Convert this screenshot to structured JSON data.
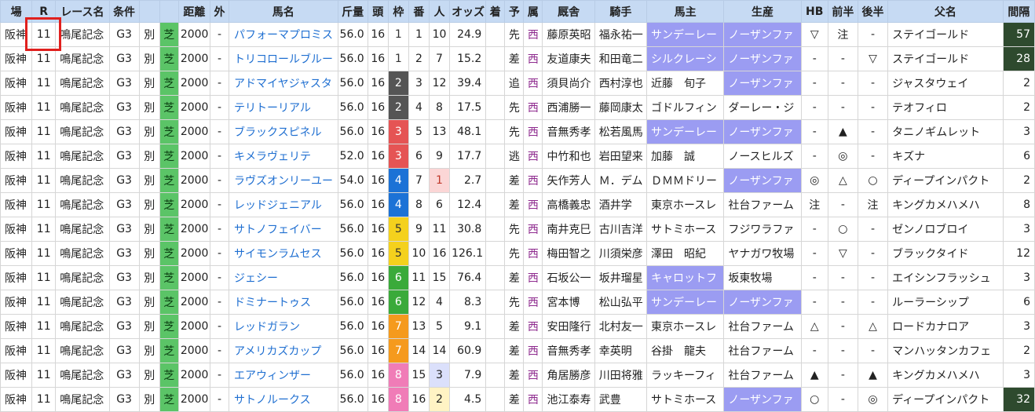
{
  "columns": [
    "場",
    "R",
    "レース名",
    "条件",
    "",
    "",
    "距離",
    "外",
    "馬名",
    "斤量",
    "頭",
    "枠",
    "番",
    "人",
    "オッズ",
    "着",
    "予",
    "属",
    "厩舎",
    "騎手",
    "馬主",
    "生産",
    "HB",
    "前半",
    "後半",
    "父名",
    "間隔"
  ],
  "rows": [
    {
      "place": "阪神",
      "r": "11",
      "race": "鳴尾記念",
      "grade": "G3",
      "cond": "別",
      "surface": "芝",
      "dist": "2000",
      "out": "-",
      "horse": "パフォーマプロミス",
      "weight": "56.0",
      "heads": "16",
      "waku": "1",
      "ban": "1",
      "pop": "10",
      "odds": "24.9",
      "finish": "",
      "style": "先",
      "zoku": "西",
      "stable": "藤原英昭",
      "jockey": "福永祐一",
      "owner": "サンデーレー",
      "breeder": "ノーザンファ",
      "hb": "▽",
      "zen": "注",
      "kou": "-",
      "sire": "ステイゴールド",
      "interval": "57"
    },
    {
      "place": "阪神",
      "r": "11",
      "race": "鳴尾記念",
      "grade": "G3",
      "cond": "別",
      "surface": "芝",
      "dist": "2000",
      "out": "-",
      "horse": "トリコロールブルー",
      "weight": "56.0",
      "heads": "16",
      "waku": "1",
      "ban": "2",
      "pop": "7",
      "odds": "15.2",
      "finish": "",
      "style": "差",
      "zoku": "西",
      "stable": "友道康夫",
      "jockey": "和田竜二",
      "owner": "シルクレーシ",
      "breeder": "ノーザンファ",
      "hb": "-",
      "zen": "-",
      "kou": "▽",
      "sire": "ステイゴールド",
      "interval": "28"
    },
    {
      "place": "阪神",
      "r": "11",
      "race": "鳴尾記念",
      "grade": "G3",
      "cond": "別",
      "surface": "芝",
      "dist": "2000",
      "out": "-",
      "horse": "アドマイヤジャスタ",
      "weight": "56.0",
      "heads": "16",
      "waku": "2",
      "ban": "3",
      "pop": "12",
      "odds": "39.4",
      "finish": "",
      "style": "追",
      "zoku": "西",
      "stable": "須貝尚介",
      "jockey": "西村淳也",
      "owner": "近藤　旬子",
      "breeder": "ノーザンファ",
      "hb": "-",
      "zen": "-",
      "kou": "-",
      "sire": "ジャスタウェイ",
      "interval": "2"
    },
    {
      "place": "阪神",
      "r": "11",
      "race": "鳴尾記念",
      "grade": "G3",
      "cond": "別",
      "surface": "芝",
      "dist": "2000",
      "out": "-",
      "horse": "テリトーリアル",
      "weight": "56.0",
      "heads": "16",
      "waku": "2",
      "ban": "4",
      "pop": "8",
      "odds": "17.5",
      "finish": "",
      "style": "先",
      "zoku": "西",
      "stable": "西浦勝一",
      "jockey": "藤岡康太",
      "owner": "ゴドルフィン",
      "breeder": "ダーレー・ジ",
      "hb": "-",
      "zen": "-",
      "kou": "-",
      "sire": "テオフィロ",
      "interval": "2"
    },
    {
      "place": "阪神",
      "r": "11",
      "race": "鳴尾記念",
      "grade": "G3",
      "cond": "別",
      "surface": "芝",
      "dist": "2000",
      "out": "-",
      "horse": "ブラックスピネル",
      "weight": "56.0",
      "heads": "16",
      "waku": "3",
      "ban": "5",
      "pop": "13",
      "odds": "48.1",
      "finish": "",
      "style": "先",
      "zoku": "西",
      "stable": "音無秀孝",
      "jockey": "松若風馬",
      "owner": "サンデーレー",
      "breeder": "ノーザンファ",
      "hb": "-",
      "zen": "▲",
      "kou": "-",
      "sire": "タニノギムレット",
      "interval": "3"
    },
    {
      "place": "阪神",
      "r": "11",
      "race": "鳴尾記念",
      "grade": "G3",
      "cond": "別",
      "surface": "芝",
      "dist": "2000",
      "out": "-",
      "horse": "キメラヴェリテ",
      "weight": "52.0",
      "heads": "16",
      "waku": "3",
      "ban": "6",
      "pop": "9",
      "odds": "17.7",
      "finish": "",
      "style": "逃",
      "zoku": "西",
      "stable": "中竹和也",
      "jockey": "岩田望来",
      "owner": "加藤　誠",
      "breeder": "ノースヒルズ",
      "hb": "-",
      "zen": "◎",
      "kou": "-",
      "sire": "キズナ",
      "interval": "6"
    },
    {
      "place": "阪神",
      "r": "11",
      "race": "鳴尾記念",
      "grade": "G3",
      "cond": "別",
      "surface": "芝",
      "dist": "2000",
      "out": "-",
      "horse": "ラヴズオンリーユー",
      "weight": "54.0",
      "heads": "16",
      "waku": "4",
      "ban": "7",
      "pop": "1",
      "odds": "2.7",
      "finish": "",
      "style": "差",
      "zoku": "西",
      "stable": "矢作芳人",
      "jockey": "Ｍ．デム",
      "owner": "ＤＭＭドリー",
      "breeder": "ノーザンファ",
      "hb": "◎",
      "zen": "△",
      "kou": "○",
      "sire": "ディープインパクト",
      "interval": "2"
    },
    {
      "place": "阪神",
      "r": "11",
      "race": "鳴尾記念",
      "grade": "G3",
      "cond": "別",
      "surface": "芝",
      "dist": "2000",
      "out": "-",
      "horse": "レッドジェニアル",
      "weight": "56.0",
      "heads": "16",
      "waku": "4",
      "ban": "8",
      "pop": "6",
      "odds": "12.4",
      "finish": "",
      "style": "差",
      "zoku": "西",
      "stable": "高橋義忠",
      "jockey": "酒井学",
      "owner": "東京ホースレ",
      "breeder": "社台ファーム",
      "hb": "注",
      "zen": "-",
      "kou": "注",
      "sire": "キングカメハメハ",
      "interval": "8"
    },
    {
      "place": "阪神",
      "r": "11",
      "race": "鳴尾記念",
      "grade": "G3",
      "cond": "別",
      "surface": "芝",
      "dist": "2000",
      "out": "-",
      "horse": "サトノフェイバー",
      "weight": "56.0",
      "heads": "16",
      "waku": "5",
      "ban": "9",
      "pop": "11",
      "odds": "30.8",
      "finish": "",
      "style": "先",
      "zoku": "西",
      "stable": "南井克巳",
      "jockey": "古川吉洋",
      "owner": "サトミホース",
      "breeder": "フジワラファ",
      "hb": "-",
      "zen": "○",
      "kou": "-",
      "sire": "ゼンノロブロイ",
      "interval": "3"
    },
    {
      "place": "阪神",
      "r": "11",
      "race": "鳴尾記念",
      "grade": "G3",
      "cond": "別",
      "surface": "芝",
      "dist": "2000",
      "out": "-",
      "horse": "サイモンラムセス",
      "weight": "56.0",
      "heads": "16",
      "waku": "5",
      "ban": "10",
      "pop": "16",
      "odds": "126.1",
      "finish": "",
      "style": "先",
      "zoku": "西",
      "stable": "梅田智之",
      "jockey": "川須栄彦",
      "owner": "澤田　昭紀",
      "breeder": "ヤナガワ牧場",
      "hb": "-",
      "zen": "▽",
      "kou": "-",
      "sire": "ブラックタイド",
      "interval": "12"
    },
    {
      "place": "阪神",
      "r": "11",
      "race": "鳴尾記念",
      "grade": "G3",
      "cond": "別",
      "surface": "芝",
      "dist": "2000",
      "out": "-",
      "horse": "ジェシー",
      "weight": "56.0",
      "heads": "16",
      "waku": "6",
      "ban": "11",
      "pop": "15",
      "odds": "76.4",
      "finish": "",
      "style": "差",
      "zoku": "西",
      "stable": "石坂公一",
      "jockey": "坂井瑠星",
      "owner": "キャロットフ",
      "breeder": "坂東牧場",
      "hb": "-",
      "zen": "-",
      "kou": "-",
      "sire": "エイシンフラッシュ",
      "interval": "3"
    },
    {
      "place": "阪神",
      "r": "11",
      "race": "鳴尾記念",
      "grade": "G3",
      "cond": "別",
      "surface": "芝",
      "dist": "2000",
      "out": "-",
      "horse": "ドミナートゥス",
      "weight": "56.0",
      "heads": "16",
      "waku": "6",
      "ban": "12",
      "pop": "4",
      "odds": "8.3",
      "finish": "",
      "style": "先",
      "zoku": "西",
      "stable": "宮本博",
      "jockey": "松山弘平",
      "owner": "サンデーレー",
      "breeder": "ノーザンファ",
      "hb": "-",
      "zen": "-",
      "kou": "-",
      "sire": "ルーラーシップ",
      "interval": "6"
    },
    {
      "place": "阪神",
      "r": "11",
      "race": "鳴尾記念",
      "grade": "G3",
      "cond": "別",
      "surface": "芝",
      "dist": "2000",
      "out": "-",
      "horse": "レッドガラン",
      "weight": "56.0",
      "heads": "16",
      "waku": "7",
      "ban": "13",
      "pop": "5",
      "odds": "9.1",
      "finish": "",
      "style": "差",
      "zoku": "西",
      "stable": "安田隆行",
      "jockey": "北村友一",
      "owner": "東京ホースレ",
      "breeder": "社台ファーム",
      "hb": "△",
      "zen": "-",
      "kou": "△",
      "sire": "ロードカナロア",
      "interval": "3"
    },
    {
      "place": "阪神",
      "r": "11",
      "race": "鳴尾記念",
      "grade": "G3",
      "cond": "別",
      "surface": "芝",
      "dist": "2000",
      "out": "-",
      "horse": "アメリカズカップ",
      "weight": "56.0",
      "heads": "16",
      "waku": "7",
      "ban": "14",
      "pop": "14",
      "odds": "60.9",
      "finish": "",
      "style": "差",
      "zoku": "西",
      "stable": "音無秀孝",
      "jockey": "幸英明",
      "owner": "谷掛　龍夫",
      "breeder": "社台ファーム",
      "hb": "-",
      "zen": "-",
      "kou": "-",
      "sire": "マンハッタンカフェ",
      "interval": "2"
    },
    {
      "place": "阪神",
      "r": "11",
      "race": "鳴尾記念",
      "grade": "G3",
      "cond": "別",
      "surface": "芝",
      "dist": "2000",
      "out": "-",
      "horse": "エアウィンザー",
      "weight": "56.0",
      "heads": "16",
      "waku": "8",
      "ban": "15",
      "pop": "3",
      "odds": "7.9",
      "finish": "",
      "style": "差",
      "zoku": "西",
      "stable": "角居勝彦",
      "jockey": "川田将雅",
      "owner": "ラッキーフィ",
      "breeder": "社台ファーム",
      "hb": "▲",
      "zen": "-",
      "kou": "▲",
      "sire": "キングカメハメハ",
      "interval": "3"
    },
    {
      "place": "阪神",
      "r": "11",
      "race": "鳴尾記念",
      "grade": "G3",
      "cond": "別",
      "surface": "芝",
      "dist": "2000",
      "out": "-",
      "horse": "サトノルークス",
      "weight": "56.0",
      "heads": "16",
      "waku": "8",
      "ban": "16",
      "pop": "2",
      "odds": "4.5",
      "finish": "",
      "style": "差",
      "zoku": "西",
      "stable": "池江泰寿",
      "jockey": "武豊",
      "owner": "サトミホース",
      "breeder": "ノーザンファ",
      "hb": "○",
      "zen": "-",
      "kou": "◎",
      "sire": "ディープインパクト",
      "interval": "32"
    }
  ],
  "highlight": {
    "owner": [
      "サンデーレー",
      "シルクレーシ",
      "キャロットフ"
    ],
    "breeder": [
      "ノーザンファ"
    ],
    "interval_dark": [
      "57",
      "28",
      "32"
    ]
  },
  "colors": {
    "header": "#c6daf3",
    "turf": "#5bc467",
    "lavender": "#9b9cf2",
    "horse_link": "#1f6fd1",
    "west": "#8e2a8e",
    "highlight_box": "#e0201e"
  }
}
